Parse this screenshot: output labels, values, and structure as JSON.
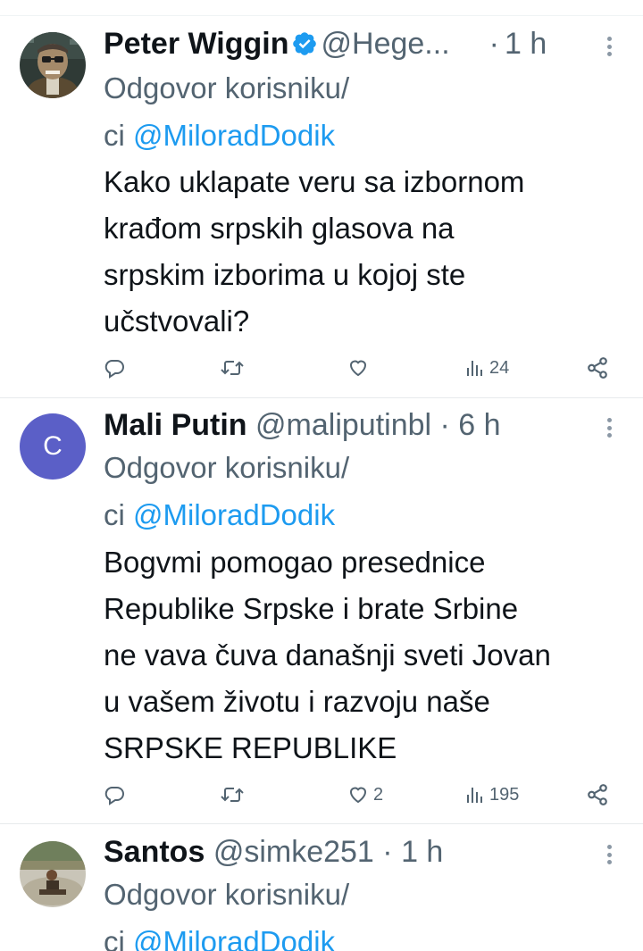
{
  "tweets": [
    {
      "name": "Peter Wiggin",
      "verified": true,
      "handle": "@Hege...",
      "separator": "·",
      "time": "1 h",
      "reply_prefix": "Odgovor korisniku/",
      "reply_line2_prefix": "ci ",
      "reply_mention": "@MiloradDodik",
      "body_lines": [
        "Kako uklapate veru sa izbornom",
        "krađom srpskih glasova na",
        "srpskim izborima u kojoj ste",
        "učstvovali?"
      ],
      "replies": "",
      "retweets": "",
      "likes": "",
      "views": "24"
    },
    {
      "name": "Mali Putin",
      "verified": false,
      "avatar_letter": "C",
      "handle": "@maliputinbl",
      "separator": "·",
      "time": "6 h",
      "reply_prefix": "Odgovor korisniku/",
      "reply_line2_prefix": "ci ",
      "reply_mention": "@MiloradDodik",
      "body_lines": [
        "Bogvmi pomogao presednice",
        "Republike Srpske i brate Srbine",
        "ne vava čuva današnji sveti Jovan",
        "u vašem životu i razvoju naše",
        "SRPSKE REPUBLIKE"
      ],
      "replies": "",
      "retweets": "",
      "likes": "2",
      "views": "195"
    },
    {
      "name": "Santos",
      "verified": false,
      "handle": "@simke251",
      "separator": "·",
      "time": "1 h",
      "reply_prefix": "Odgovor korisniku/",
      "reply_line2_prefix": "ci ",
      "reply_mention": "@MiloradDodik"
    }
  ],
  "icons": {
    "reply": "reply-icon",
    "retweet": "retweet-icon",
    "like": "heart-icon",
    "views": "views-icon",
    "share": "share-icon",
    "verified": "verified-badge-icon",
    "more": "more-icon"
  },
  "colors": {
    "text": "#0f1419",
    "secondary": "#536471",
    "link": "#1d9bf0",
    "verified": "#1d9bf0",
    "avatar_c": "#5b5fc7",
    "divider": "#e7eaec"
  }
}
